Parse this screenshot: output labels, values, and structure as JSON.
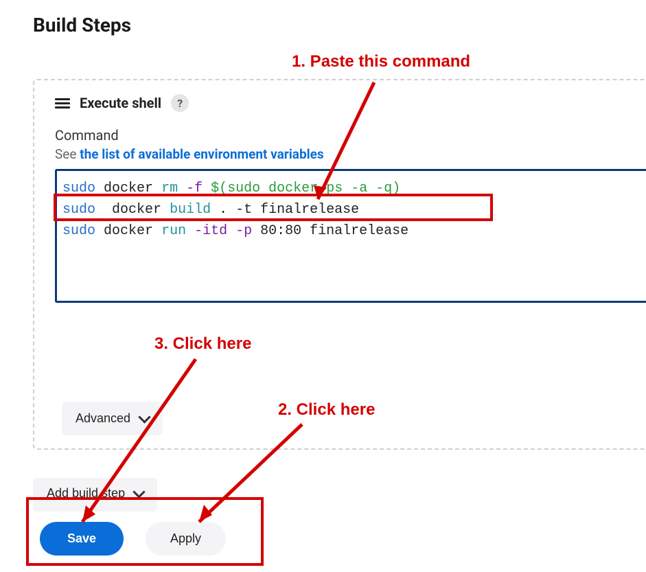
{
  "page": {
    "heading": "Build Steps"
  },
  "step": {
    "title": "Execute shell",
    "help_symbol": "?",
    "command_label": "Command",
    "see_prefix": "See ",
    "see_link": "the list of available environment variables",
    "code": {
      "line1": {
        "sudo": "sudo",
        "docker": "docker",
        "rm": "rm",
        "flag": "-f",
        "sub_open": "$(",
        "sub_sudo": "sudo",
        "sub_docker": "docker",
        "sub_ps": "ps",
        "sub_flags": "-a -q",
        "sub_close": ")"
      },
      "line2": {
        "sudo": "sudo",
        "docker": "docker",
        "build": "build",
        "rest": ". -t finalrelease"
      },
      "line3": {
        "sudo": "sudo",
        "docker": "docker",
        "run": "run",
        "flags": "-itd -p",
        "ports": "80:80",
        "image": "finalrelease"
      }
    },
    "advanced_label": "Advanced"
  },
  "actions": {
    "add_build_step": "Add build step",
    "save": "Save",
    "apply": "Apply"
  },
  "annotations": {
    "a1": "1. Paste this command",
    "a2": "2. Click here",
    "a3": "3. Click here"
  }
}
